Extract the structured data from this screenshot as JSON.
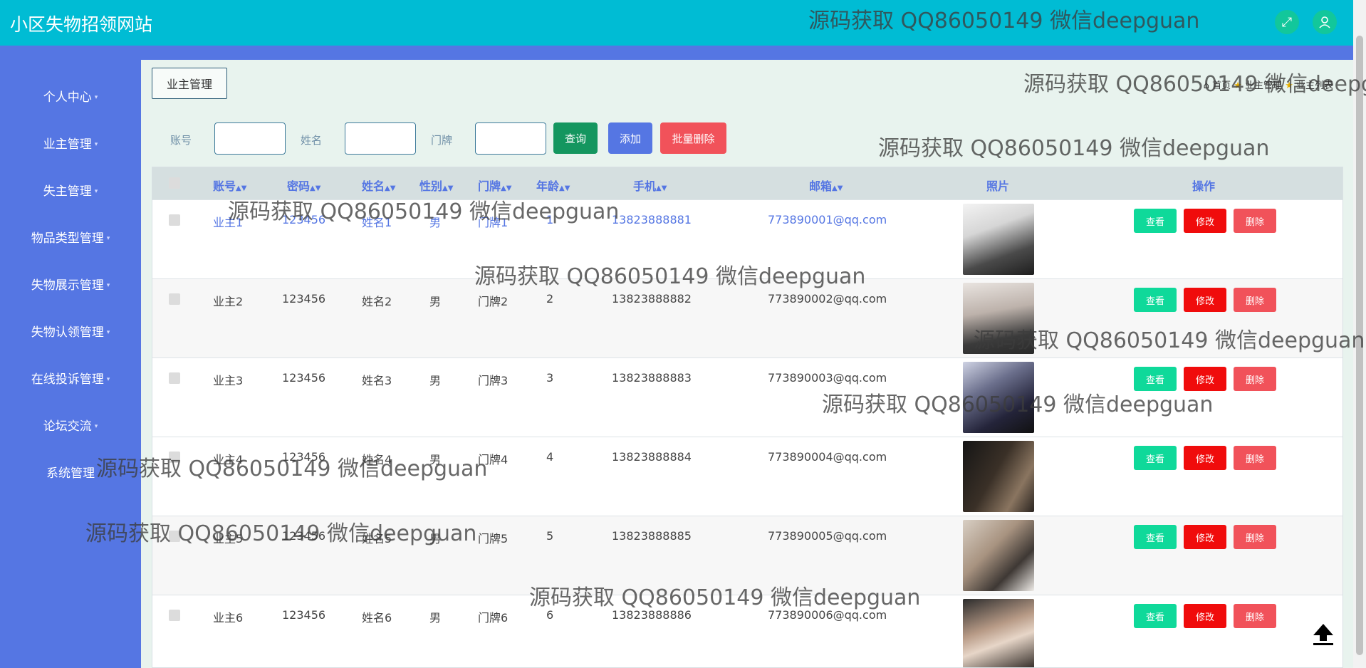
{
  "header": {
    "site_title": "小区失物招领网站",
    "icons": [
      "fullscreen-icon",
      "user-icon"
    ]
  },
  "sidebar": {
    "items": [
      {
        "label": "个人中心"
      },
      {
        "label": "业主管理"
      },
      {
        "label": "失主管理"
      },
      {
        "label": "物品类型管理"
      },
      {
        "label": "失物展示管理"
      },
      {
        "label": "失物认领管理"
      },
      {
        "label": "在线投诉管理"
      },
      {
        "label": "论坛交流"
      },
      {
        "label": "系统管理"
      }
    ]
  },
  "tab": {
    "label": "业主管理"
  },
  "breadcrumb": {
    "home": "首页",
    "section": "业主管理",
    "page": "业主列表"
  },
  "search": {
    "account_label": "账号",
    "name_label": "姓名",
    "door_label": "门牌",
    "account_value": "",
    "name_value": "",
    "door_value": ""
  },
  "buttons": {
    "query": "查询",
    "add": "添加",
    "batch_delete": "批量删除"
  },
  "table": {
    "columns": [
      "账号",
      "密码",
      "姓名",
      "性别",
      "门牌",
      "年龄",
      "手机",
      "邮箱",
      "照片",
      "操作"
    ],
    "actions": {
      "view": "查看",
      "edit": "修改",
      "delete": "删除"
    },
    "rows": [
      {
        "account": "业主1",
        "password": "123456",
        "name": "姓名1",
        "gender": "男",
        "door": "门牌1",
        "age": "1",
        "phone": "13823888881",
        "email": "773890001@qq.com"
      },
      {
        "account": "业主2",
        "password": "123456",
        "name": "姓名2",
        "gender": "男",
        "door": "门牌2",
        "age": "2",
        "phone": "13823888882",
        "email": "773890002@qq.com"
      },
      {
        "account": "业主3",
        "password": "123456",
        "name": "姓名3",
        "gender": "男",
        "door": "门牌3",
        "age": "3",
        "phone": "13823888883",
        "email": "773890003@qq.com"
      },
      {
        "account": "业主4",
        "password": "123456",
        "name": "姓名4",
        "gender": "男",
        "door": "门牌4",
        "age": "4",
        "phone": "13823888884",
        "email": "773890004@qq.com"
      },
      {
        "account": "业主5",
        "password": "123456",
        "name": "姓名5",
        "gender": "男",
        "door": "门牌5",
        "age": "5",
        "phone": "13823888885",
        "email": "773890005@qq.com"
      },
      {
        "account": "业主6",
        "password": "123456",
        "name": "姓名6",
        "gender": "男",
        "door": "门牌6",
        "age": "6",
        "phone": "13823888886",
        "email": "773890006@qq.com"
      }
    ]
  },
  "watermark": "源码获取 QQ86050149 微信deepguan",
  "colors": {
    "header": "#00bcd4",
    "sidebar": "#5576e3",
    "query": "#14965f",
    "add": "#5576e3",
    "delete": "#f1525a"
  }
}
